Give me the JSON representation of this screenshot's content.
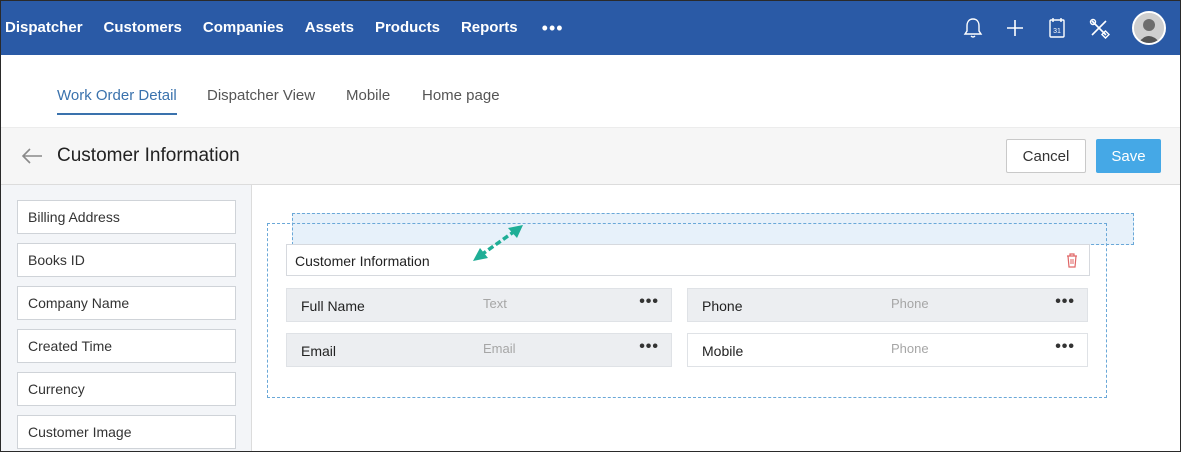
{
  "topnav": {
    "items": [
      "Dispatcher",
      "Customers",
      "Companies",
      "Assets",
      "Products",
      "Reports"
    ],
    "more_label": "•••",
    "icons": [
      "bell-icon",
      "plus-icon",
      "calendar-icon",
      "tools-icon"
    ],
    "calendar_day": "31",
    "bg_color": "#2a5aa6"
  },
  "tabs": [
    {
      "label": "Work Order Detail",
      "active": true
    },
    {
      "label": "Dispatcher View",
      "active": false
    },
    {
      "label": "Mobile",
      "active": false
    },
    {
      "label": "Home page",
      "active": false
    }
  ],
  "header": {
    "title": "Customer Information",
    "cancel_label": "Cancel",
    "save_label": "Save",
    "save_color": "#45a8e6"
  },
  "sidebar": {
    "fields": [
      "Billing Address",
      "Books ID",
      "Company Name",
      "Created Time",
      "Currency",
      "Customer Image"
    ]
  },
  "section": {
    "title": "Customer Information",
    "fields": [
      {
        "label": "Full Name",
        "placeholder": "Text",
        "more": "•••"
      },
      {
        "label": "Phone",
        "placeholder": "Phone",
        "more": "•••"
      },
      {
        "label": "Email",
        "placeholder": "Email",
        "more": "•••"
      },
      {
        "label": "Mobile",
        "placeholder": "Phone",
        "more": "•••"
      }
    ]
  },
  "accent_color": "#1fae96"
}
